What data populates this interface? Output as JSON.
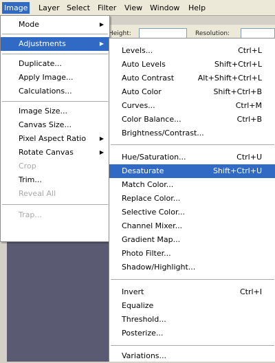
{
  "menubar": {
    "items": [
      "Image",
      "Layer",
      "Select",
      "Filter",
      "View",
      "Window",
      "Help"
    ]
  },
  "options_bar": {
    "height_label": "Height:",
    "resolution_label": "Resolution:"
  },
  "image_menu": {
    "mode": "Mode",
    "adjustments": "Adjustments",
    "duplicate": "Duplicate...",
    "apply_image": "Apply Image...",
    "calculations": "Calculations...",
    "image_size": "Image Size...",
    "canvas_size": "Canvas Size...",
    "pixel_aspect_ratio": "Pixel Aspect Ratio",
    "rotate_canvas": "Rotate Canvas",
    "crop": "Crop",
    "trim": "Trim...",
    "reveal_all": "Reveal All",
    "trap": "Trap..."
  },
  "adjustments_menu": {
    "levels": {
      "label": "Levels...",
      "shortcut": "Ctrl+L"
    },
    "auto_levels": {
      "label": "Auto Levels",
      "shortcut": "Shift+Ctrl+L"
    },
    "auto_contrast": {
      "label": "Auto Contrast",
      "shortcut": "Alt+Shift+Ctrl+L"
    },
    "auto_color": {
      "label": "Auto Color",
      "shortcut": "Shift+Ctrl+B"
    },
    "curves": {
      "label": "Curves...",
      "shortcut": "Ctrl+M"
    },
    "color_balance": {
      "label": "Color Balance...",
      "shortcut": "Ctrl+B"
    },
    "brightness_contrast": {
      "label": "Brightness/Contrast..."
    },
    "hue_saturation": {
      "label": "Hue/Saturation...",
      "shortcut": "Ctrl+U"
    },
    "desaturate": {
      "label": "Desaturate",
      "shortcut": "Shift+Ctrl+U"
    },
    "match_color": {
      "label": "Match Color..."
    },
    "replace_color": {
      "label": "Replace Color..."
    },
    "selective_color": {
      "label": "Selective Color..."
    },
    "channel_mixer": {
      "label": "Channel Mixer..."
    },
    "gradient_map": {
      "label": "Gradient Map..."
    },
    "photo_filter": {
      "label": "Photo Filter..."
    },
    "shadow_highlight": {
      "label": "Shadow/Highlight..."
    },
    "invert": {
      "label": "Invert",
      "shortcut": "Ctrl+I"
    },
    "equalize": {
      "label": "Equalize"
    },
    "threshold": {
      "label": "Threshold..."
    },
    "posterize": {
      "label": "Posterize..."
    },
    "variations": {
      "label": "Variations..."
    }
  },
  "colors": {
    "highlight": "#316ac5",
    "menu_bg": "#ffffff",
    "disabled_text": "#a8a8a8",
    "canvas": "#5a5a72"
  }
}
